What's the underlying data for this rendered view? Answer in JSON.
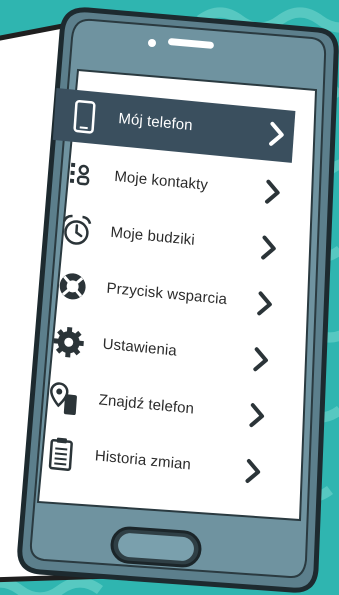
{
  "colors": {
    "teal_bg": "#2fb5b0",
    "wave_light": "#58c9c1",
    "phone_body": "#5c7f8c",
    "phone_dark": "#2a3a40",
    "screen_bg": "#ffffff",
    "active_row": "#3a4f5e",
    "icon_dark": "#2b3438",
    "speech_bubble": "#ffffff"
  },
  "menu": {
    "items": [
      {
        "label": "Mój telefon",
        "icon": "phone-icon",
        "active": true
      },
      {
        "label": "Moje kontakty",
        "icon": "contacts-icon",
        "active": false
      },
      {
        "label": "Moje budziki",
        "icon": "alarm-clock-icon",
        "active": false
      },
      {
        "label": "Przycisk wsparcia",
        "icon": "support-button-icon",
        "active": false
      },
      {
        "label": "Ustawienia",
        "icon": "settings-gear-icon",
        "active": false
      },
      {
        "label": "Znajdź telefon",
        "icon": "find-phone-icon",
        "active": false
      },
      {
        "label": "Historia zmian",
        "icon": "history-clipboard-icon",
        "active": false
      }
    ]
  }
}
